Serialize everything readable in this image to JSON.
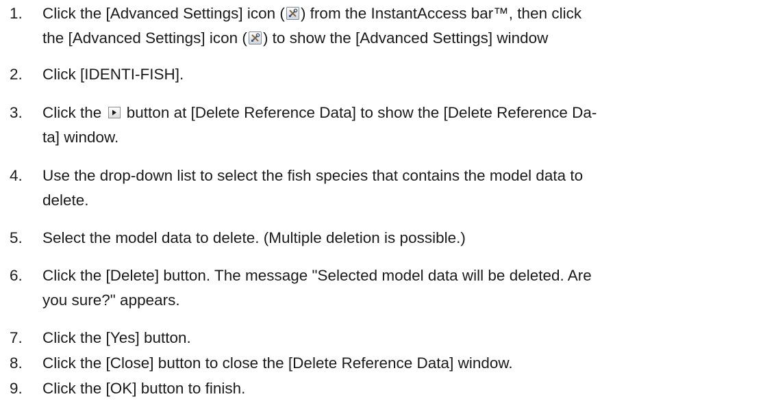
{
  "steps": [
    {
      "num": "1.",
      "parts": [
        "Click the [Advanced Settings] icon (",
        ") from the InstantAccess bar™, then click",
        "the [Advanced Settings] icon (",
        ") to show the [Advanced Settings] window"
      ]
    },
    {
      "num": "2.",
      "text": "Click [IDENTI-FISH]."
    },
    {
      "num": "3.",
      "parts": [
        "Click the ",
        " button at [Delete Reference Data] to show the [Delete Reference Da-",
        "ta] window."
      ]
    },
    {
      "num": "4.",
      "lines": [
        "Use the drop-down list to select the fish species that contains the model data to",
        "delete."
      ]
    },
    {
      "num": "5.",
      "text": "Select the model data to delete. (Multiple deletion is possible.)"
    },
    {
      "num": "6.",
      "lines": [
        "Click the [Delete] button. The message \"Selected model data will be deleted. Are",
        "you sure?\" appears."
      ]
    },
    {
      "num": "7.",
      "text": "Click the [Yes] button."
    },
    {
      "num": "8.",
      "text": "Click the [Close] button to close the [Delete Reference Data] window."
    },
    {
      "num": "9.",
      "text": "Click the [OK] button to finish."
    }
  ],
  "icons": {
    "advanced_settings": "tools-icon",
    "expand_button": "play-triangle-icon"
  }
}
